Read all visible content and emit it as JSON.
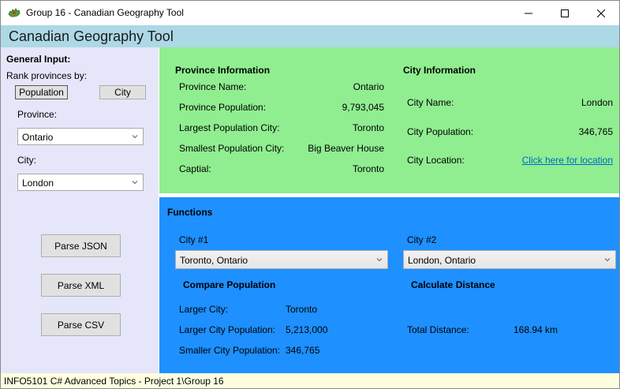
{
  "window": {
    "title": "Group 16 - Canadian Geography Tool",
    "app_icon": "maple-leaf-map-icon"
  },
  "header": {
    "title": "Canadian Geography Tool"
  },
  "general_input": {
    "title": "General Input:",
    "rank_label": "Rank provinces by:",
    "population_button": "Population",
    "city_button": "City",
    "province_label": "Province:",
    "province_value": "Ontario",
    "city_label": "City:",
    "city_value": "London",
    "parse_json": "Parse JSON",
    "parse_xml": "Parse XML",
    "parse_csv": "Parse CSV"
  },
  "province_info": {
    "title": "Province Information",
    "name_label": "Province Name:",
    "name_value": "Ontario",
    "population_label": "Province Population:",
    "population_value": "9,793,045",
    "largest_label": "Largest Population City:",
    "largest_value": "Toronto",
    "smallest_label": "Smallest Population City:",
    "smallest_value": "Big Beaver House",
    "capital_label": "Captial:",
    "capital_value": "Toronto"
  },
  "city_info": {
    "title": "City Information",
    "name_label": "City Name:",
    "name_value": "London",
    "population_label": "City Population:",
    "population_value": "346,765",
    "location_label": "City Location:",
    "location_link": "Click here for location"
  },
  "functions": {
    "title": "Functions",
    "city1_label": "City #1",
    "city1_value": "Toronto, Ontario",
    "city2_label": "City #2",
    "city2_value": "London, Ontario",
    "compare_title": "Compare Population",
    "larger_city_label": "Larger City:",
    "larger_city_value": "Toronto",
    "larger_pop_label": "Larger City Population:",
    "larger_pop_value": "5,213,000",
    "smaller_pop_label": "Smaller City Population:",
    "smaller_pop_value": "346,765",
    "distance_title": "Calculate Distance",
    "total_distance_label": "Total Distance:",
    "total_distance_value": "168.94 km"
  },
  "status": {
    "text": "INFO5101 C# Advanced Topics - Project 1\\Group 16"
  },
  "colors": {
    "header": "#add8e6",
    "left_panel": "#e6e6fa",
    "info_panel": "#90ee90",
    "functions_panel": "#1e90ff",
    "status_bar": "#ffffe0",
    "link": "#0066cc"
  }
}
